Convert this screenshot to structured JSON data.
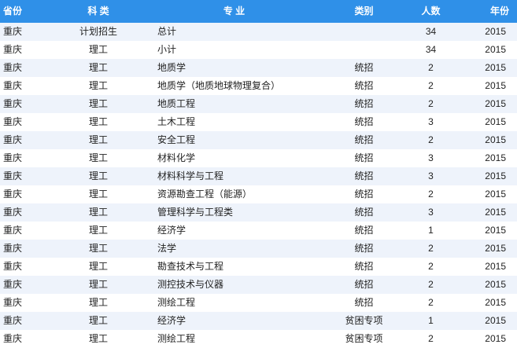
{
  "header": {
    "province": "省份",
    "category": "科 类",
    "major": "专 业",
    "type": "类别",
    "count": "人数",
    "year": "年份"
  },
  "rows": [
    {
      "province": "重庆",
      "category": "计划招生",
      "major": "总计",
      "type": "",
      "count": "34",
      "year": "2015"
    },
    {
      "province": "重庆",
      "category": "理工",
      "major": "小计",
      "type": "",
      "count": "34",
      "year": "2015"
    },
    {
      "province": "重庆",
      "category": "理工",
      "major": "地质学",
      "type": "统招",
      "count": "2",
      "year": "2015"
    },
    {
      "province": "重庆",
      "category": "理工",
      "major": "地质学（地质地球物理复合）",
      "type": "统招",
      "count": "2",
      "year": "2015"
    },
    {
      "province": "重庆",
      "category": "理工",
      "major": "地质工程",
      "type": "统招",
      "count": "2",
      "year": "2015"
    },
    {
      "province": "重庆",
      "category": "理工",
      "major": "土木工程",
      "type": "统招",
      "count": "3",
      "year": "2015"
    },
    {
      "province": "重庆",
      "category": "理工",
      "major": "安全工程",
      "type": "统招",
      "count": "2",
      "year": "2015"
    },
    {
      "province": "重庆",
      "category": "理工",
      "major": "材料化学",
      "type": "统招",
      "count": "3",
      "year": "2015"
    },
    {
      "province": "重庆",
      "category": "理工",
      "major": "材料科学与工程",
      "type": "统招",
      "count": "3",
      "year": "2015"
    },
    {
      "province": "重庆",
      "category": "理工",
      "major": "资源勘查工程（能源）",
      "type": "统招",
      "count": "2",
      "year": "2015"
    },
    {
      "province": "重庆",
      "category": "理工",
      "major": "管理科学与工程类",
      "type": "统招",
      "count": "3",
      "year": "2015"
    },
    {
      "province": "重庆",
      "category": "理工",
      "major": "经济学",
      "type": "统招",
      "count": "1",
      "year": "2015"
    },
    {
      "province": "重庆",
      "category": "理工",
      "major": "法学",
      "type": "统招",
      "count": "2",
      "year": "2015"
    },
    {
      "province": "重庆",
      "category": "理工",
      "major": "勘查技术与工程",
      "type": "统招",
      "count": "2",
      "year": "2015"
    },
    {
      "province": "重庆",
      "category": "理工",
      "major": "测控技术与仪器",
      "type": "统招",
      "count": "2",
      "year": "2015"
    },
    {
      "province": "重庆",
      "category": "理工",
      "major": "测绘工程",
      "type": "统招",
      "count": "2",
      "year": "2015"
    },
    {
      "province": "重庆",
      "category": "理工",
      "major": "经济学",
      "type": "贫困专项",
      "count": "1",
      "year": "2015"
    },
    {
      "province": "重庆",
      "category": "理工",
      "major": "测绘工程",
      "type": "贫困专项",
      "count": "2",
      "year": "2015"
    }
  ],
  "colors": {
    "header_bg": "#2f90e8",
    "header_text": "#ffffff",
    "row_alt_bg": "#eef3fb",
    "row_plain_bg": "#ffffff"
  }
}
